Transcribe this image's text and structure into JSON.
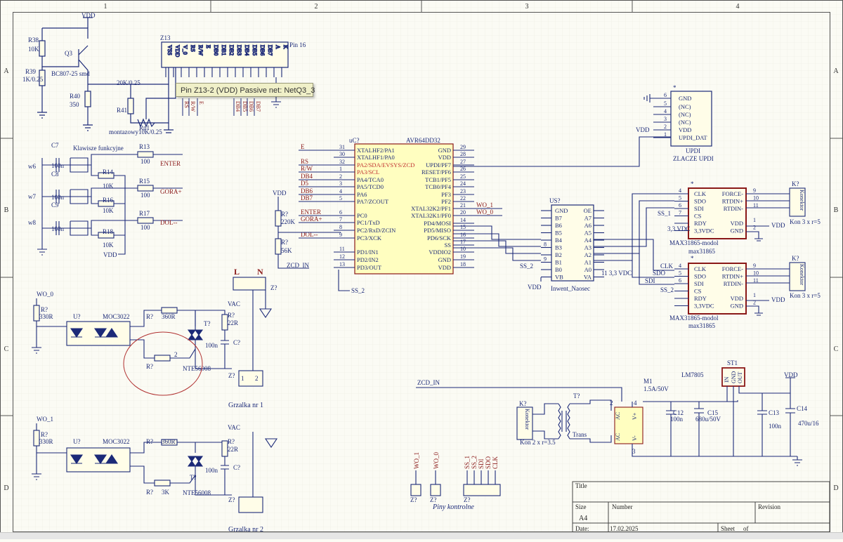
{
  "sheet": {
    "zones_top": [
      "1",
      "2",
      "3",
      "4"
    ],
    "zones_side": [
      "A",
      "B",
      "C",
      "D"
    ]
  },
  "tooltip": {
    "text": "Pin Z13-2 (VDD) Passive    net: NetQ3_3"
  },
  "power": {
    "vdd": "VDD",
    "vac": "VAC"
  },
  "backlight": {
    "r38": "R38",
    "r38_val": "10K",
    "r39": "R39",
    "r39_val": "1K/0.25",
    "q3": "Q3",
    "q3_part": "BC807-25 smd",
    "r40": "R40",
    "r40_val": "350",
    "r41": "R41",
    "r41_val": "20K/0.25",
    "rp1": "Rp1",
    "rp1_val": "montazowy10K/0.25"
  },
  "lcd": {
    "designator": "Z13",
    "pin_label": "Pin 16",
    "pins": [
      "VSS",
      "VDD",
      "V_0",
      "RS",
      "R/W",
      "E",
      "DB0",
      "DB1",
      "DB2",
      "DB3",
      "DB4",
      "DB5",
      "DB6",
      "DB7",
      "A",
      "K"
    ],
    "bottom_nets": [
      "RS",
      "R/W",
      "E",
      "DB4",
      "DB5",
      "DB6",
      "DB7"
    ]
  },
  "keys": {
    "title": "Klawisze funkcyjne",
    "c7": "C7",
    "c8": "C8",
    "c9": "C9",
    "cap_val": "100n",
    "w6": "w6",
    "w7": "w7",
    "w8": "w8",
    "r13": "R13",
    "r14": "R14",
    "r15": "R15",
    "r16": "R16",
    "r17": "R17",
    "r18": "R18",
    "r_top_val": "100",
    "r_pull_val": "10K",
    "enter": "ENTER",
    "gora": "GORA+",
    "dol": "DOL--",
    "vdd": "VDD"
  },
  "mcu": {
    "designator": "uC?",
    "part": "AVR64DD32",
    "left_pins": [
      {
        "num": "31",
        "name": "XTALHF2/PA1",
        "net": "E"
      },
      {
        "num": "30",
        "name": "XTALHF1/PA0",
        "net": ""
      },
      {
        "num": "32",
        "name": "PA2/SDA/EVSYS/ZCD",
        "net": "RS"
      },
      {
        "num": "1",
        "name": "PA3/SCL",
        "net": "R/W"
      },
      {
        "num": "2",
        "name": "PA4/TCA0",
        "net": "DB4"
      },
      {
        "num": "3",
        "name": "PA5/TCD0",
        "net": "D5"
      },
      {
        "num": "4",
        "name": "PA6",
        "net": "DB6"
      },
      {
        "num": "5",
        "name": "PA7/ZCOUT",
        "net": "DB7"
      },
      {
        "num": "6",
        "name": "PC0",
        "net": "ENTER"
      },
      {
        "num": "7",
        "name": "PC1/TxD",
        "net": "GORA+"
      },
      {
        "num": "8",
        "name": "PC2/RxD/ZCIN",
        "net": ""
      },
      {
        "num": "9",
        "name": "PC3/XCK",
        "net": "DOL--"
      },
      {
        "num": "11",
        "name": "PD1/IN1",
        "net": ""
      },
      {
        "num": "12",
        "name": "PD2/IN2",
        "net": ""
      },
      {
        "num": "13",
        "name": "PD3/OUT",
        "net": ""
      }
    ],
    "right_pins": [
      {
        "num": "29",
        "name": "GND",
        "net": ""
      },
      {
        "num": "28",
        "name": "VDD",
        "net": ""
      },
      {
        "num": "27",
        "name": "UPDI/PF7",
        "net": ""
      },
      {
        "num": "26",
        "name": "RESET/PF6",
        "net": ""
      },
      {
        "num": "25",
        "name": "TCB1/PF5",
        "net": ""
      },
      {
        "num": "24",
        "name": "TCB0/PF4",
        "net": ""
      },
      {
        "num": "23",
        "name": "PF3",
        "net": ""
      },
      {
        "num": "22",
        "name": "PF2",
        "net": ""
      },
      {
        "num": "21",
        "name": "XTAL32K2/PF1",
        "net": "WO_1"
      },
      {
        "num": "20",
        "name": "XTAL32K1/PF0",
        "net": "WO_0"
      },
      {
        "num": "14",
        "name": "PD4/MOSI",
        "net": ""
      },
      {
        "num": "15",
        "name": "PD5/MISO",
        "net": ""
      },
      {
        "num": "16",
        "name": "PD6/SCK",
        "net": ""
      },
      {
        "num": "17",
        "name": "SS",
        "net": ""
      },
      {
        "num": "10",
        "name": "VDDIO2",
        "net": ""
      },
      {
        "num": "19",
        "name": "GND",
        "net": ""
      },
      {
        "num": "18",
        "name": "VDD",
        "net": ""
      }
    ],
    "ss2": "SS_2"
  },
  "divider": {
    "vdd": "VDD",
    "r1": "R?",
    "r1_val": "220K",
    "r2": "R?",
    "r2_val": "56K",
    "zcd": "ZCD_IN"
  },
  "updi": {
    "marker": "*",
    "pins": [
      {
        "num": "6",
        "name": "GND"
      },
      {
        "num": "5",
        "name": "(NC)"
      },
      {
        "num": "4",
        "name": "(NC)"
      },
      {
        "num": "3",
        "name": "(NC)"
      },
      {
        "num": "2",
        "name": "VDD"
      },
      {
        "num": "1",
        "name": "UPDI_DAT"
      }
    ],
    "vdd": "VDD",
    "label1": "UPDI",
    "label2": "ZLACZE UPDI"
  },
  "levelshift": {
    "designator": "US?",
    "left": [
      {
        "num": "",
        "name": "GND"
      },
      {
        "num": "",
        "name": "B7"
      },
      {
        "num": "",
        "name": "B6"
      },
      {
        "num": "",
        "name": "B5"
      },
      {
        "num": "",
        "name": "B4"
      },
      {
        "num": "8",
        "name": "B3"
      },
      {
        "num": "",
        "name": "B2"
      },
      {
        "num": "9",
        "name": "B1"
      },
      {
        "num": "",
        "name": "B0"
      },
      {
        "num": "",
        "name": "VB"
      }
    ],
    "right": [
      "OE",
      "A7",
      "A6",
      "A5",
      "A4",
      "A3",
      "A2",
      "A1",
      "A0",
      "VA"
    ],
    "label": "Inwent_Naosec",
    "vdd": "VDD",
    "ss2": "SS_2",
    "va_net": "11 3,3 VDC"
  },
  "max1": {
    "marker": "*",
    "left": [
      {
        "num": "4",
        "name": "CLK"
      },
      {
        "num": "5",
        "name": "SDO"
      },
      {
        "num": "6",
        "name": "SDI"
      },
      {
        "num": "7",
        "name": "CS"
      },
      {
        "num": "",
        "name": "RDY"
      },
      {
        "num": "",
        "name": "3,3VDC"
      }
    ],
    "right": [
      {
        "num": "9",
        "name": "FORCE-"
      },
      {
        "num": "10",
        "name": "RTDIN+"
      },
      {
        "num": "11",
        "name": "RTDIN-"
      },
      {
        "num": "",
        "name": ""
      },
      {
        "num": "1",
        "name": "VDD"
      },
      {
        "num": "2",
        "name": "GND"
      }
    ],
    "label1": "MAX31865-modol",
    "label2": "max31865",
    "ss": "SS_1",
    "vdd": "VDD",
    "v33": "3,3 VDC",
    "kon": "K?",
    "kon_name": "Konektor",
    "kon_label": "Kon 3 x r=5"
  },
  "max2": {
    "marker": "*",
    "left": [
      {
        "num": "4",
        "name": "CLK"
      },
      {
        "num": "5",
        "name": "SDO"
      },
      {
        "num": "6",
        "name": "SDI"
      },
      {
        "num": "",
        "name": "CS"
      },
      {
        "num": "",
        "name": "RDY"
      },
      {
        "num": "",
        "name": "3,3VDC"
      }
    ],
    "right": [
      {
        "num": "9",
        "name": "FORCE-"
      },
      {
        "num": "10",
        "name": "RTDIN+"
      },
      {
        "num": "11",
        "name": "RTDIN-"
      },
      {
        "num": "",
        "name": ""
      },
      {
        "num": "1",
        "name": "VDD"
      },
      {
        "num": "2",
        "name": "GND"
      }
    ],
    "label1": "MAX31865-modol",
    "label2": "max31865",
    "ss": "SS_2",
    "clk": "CLK",
    "sdo": "SDO",
    "sdi": "SDI",
    "vdd": "VDD",
    "kon": "K?",
    "kon_name": "Konektor",
    "kon_label": "Kon 3 x r=5"
  },
  "heater1": {
    "wo": "WO_0",
    "r1": "R?",
    "r1_val": "330R",
    "opto": "U?",
    "opto_part": "MOC3022",
    "r2": "R?",
    "r2_val": "360R",
    "r3": "R?",
    "triac": "T?",
    "triac_part": "NTE56008",
    "rs": "R?",
    "rs_val": "22R",
    "c": "C?",
    "c_val": "100n",
    "vac": "VAC",
    "L": "L",
    "N": "N",
    "z": "Z?",
    "z2": "Z?",
    "name": "Grzalka nr 1",
    "pin1": "1",
    "pin2": "2"
  },
  "heater2": {
    "wo": "WO_1",
    "r1": "R?",
    "r1_val": "330R",
    "opto": "U?",
    "opto_part": "MOC3022",
    "r2": "R?",
    "r2_val": "360R",
    "r3": "R?",
    "r3_val": "3K",
    "triac": "T?",
    "triac_part": "NTE56008",
    "rs": "R?",
    "rs_val": "22R",
    "c": "C?",
    "c_val": "100n",
    "vac": "VAC",
    "z": "Z?",
    "name": "Grzalka nr 2"
  },
  "psu": {
    "zcd": "ZCD_IN",
    "m1": "M1",
    "m1_val": "1.5A/50V",
    "st1": "ST1",
    "reg": "LM7805",
    "reg_pins": [
      "IN",
      "GND",
      "OUT"
    ],
    "c12": "C12",
    "c12_val": "100n",
    "c15": "C15",
    "c15_val": "680u/50V",
    "c13": "C13",
    "c13_val": "100n",
    "c14": "C14",
    "c14_val": "470u/16",
    "t": "T?",
    "t_label": "Trans",
    "kon": "K?",
    "kon_name": "Konektor",
    "kon_label": "Kon 2 x r=3.5",
    "vdd": "VDD",
    "bridge": [
      "AC",
      "V+",
      "AC",
      "V-"
    ],
    "pin2": "2",
    "pin3": "3",
    "pin4": "4"
  },
  "control": {
    "labels": [
      "WO_1",
      "WO_0"
    ],
    "z1": "Z?",
    "z2": "Z?",
    "z3": "Z?",
    "spi": [
      "SS_1",
      "SS_2",
      "SDI",
      "SDO",
      "CLK"
    ],
    "title": "Piny kontrolne"
  },
  "titleblock": {
    "title": "Title",
    "size": "Size",
    "size_val": "A4",
    "number": "Number",
    "revision": "Revision",
    "date": "Date:",
    "date_val": "17.02.2025",
    "sheet": "Sheet",
    "of": "of"
  }
}
